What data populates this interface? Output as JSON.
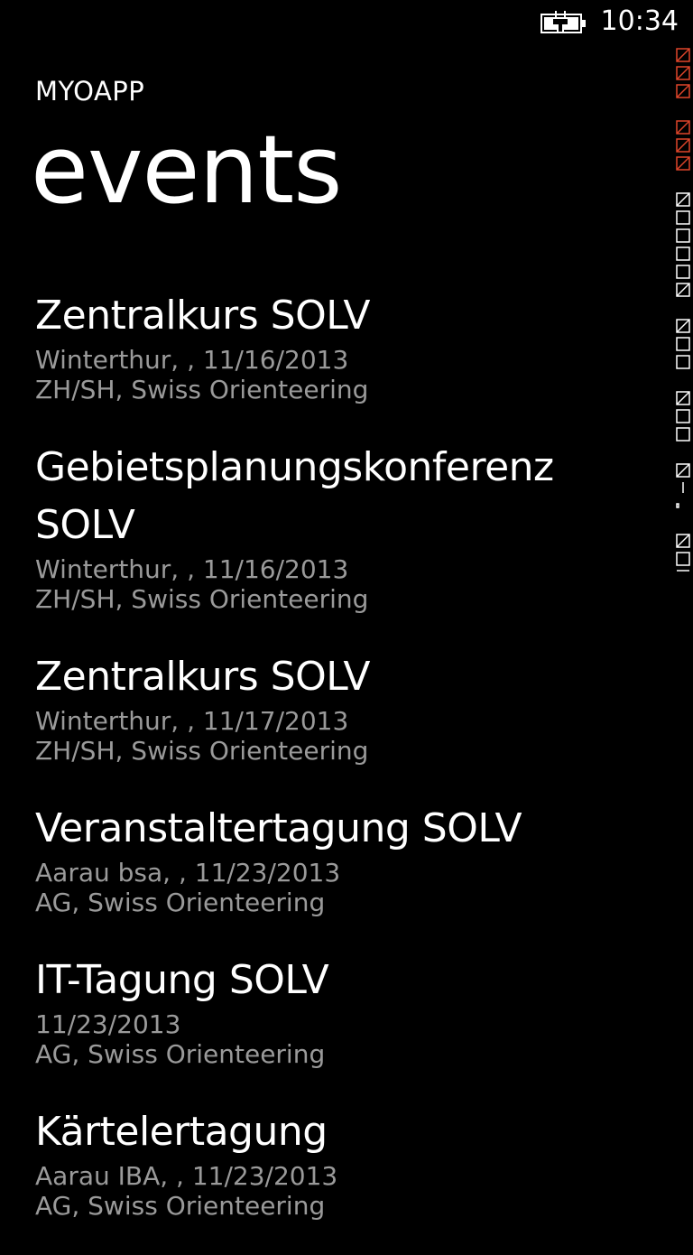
{
  "status_bar": {
    "time": "10:34",
    "battery_icon": "battery-charging-icon"
  },
  "header": {
    "app_title": "MYOAPP",
    "page_title": "events"
  },
  "events": [
    {
      "title": "Zentralkurs SOLV",
      "line1": "Winterthur, , 11/16/2013",
      "line2": "ZH/SH, Swiss Orienteering"
    },
    {
      "title": "Gebietsplanungskonferenz SOLV",
      "line1": "Winterthur, , 11/16/2013",
      "line2": "ZH/SH, Swiss Orienteering"
    },
    {
      "title": "Zentralkurs SOLV",
      "line1": "Winterthur, , 11/17/2013",
      "line2": "ZH/SH, Swiss Orienteering"
    },
    {
      "title": "Veranstaltertagung SOLV",
      "line1": "Aarau bsa, , 11/23/2013",
      "line2": "AG, Swiss Orienteering"
    },
    {
      "title": "IT-Tagung SOLV",
      "line1": "11/23/2013",
      "line2": "AG, Swiss Orienteering"
    },
    {
      "title": "Kärtelertagung",
      "line1": "Aarau IBA, , 11/23/2013",
      "line2": "AG, Swiss Orienteering"
    }
  ],
  "colors": {
    "background": "#000000",
    "primary_text": "#ffffff",
    "secondary_text": "#9a9a9a",
    "debug_counter_red": "#e0452a"
  }
}
